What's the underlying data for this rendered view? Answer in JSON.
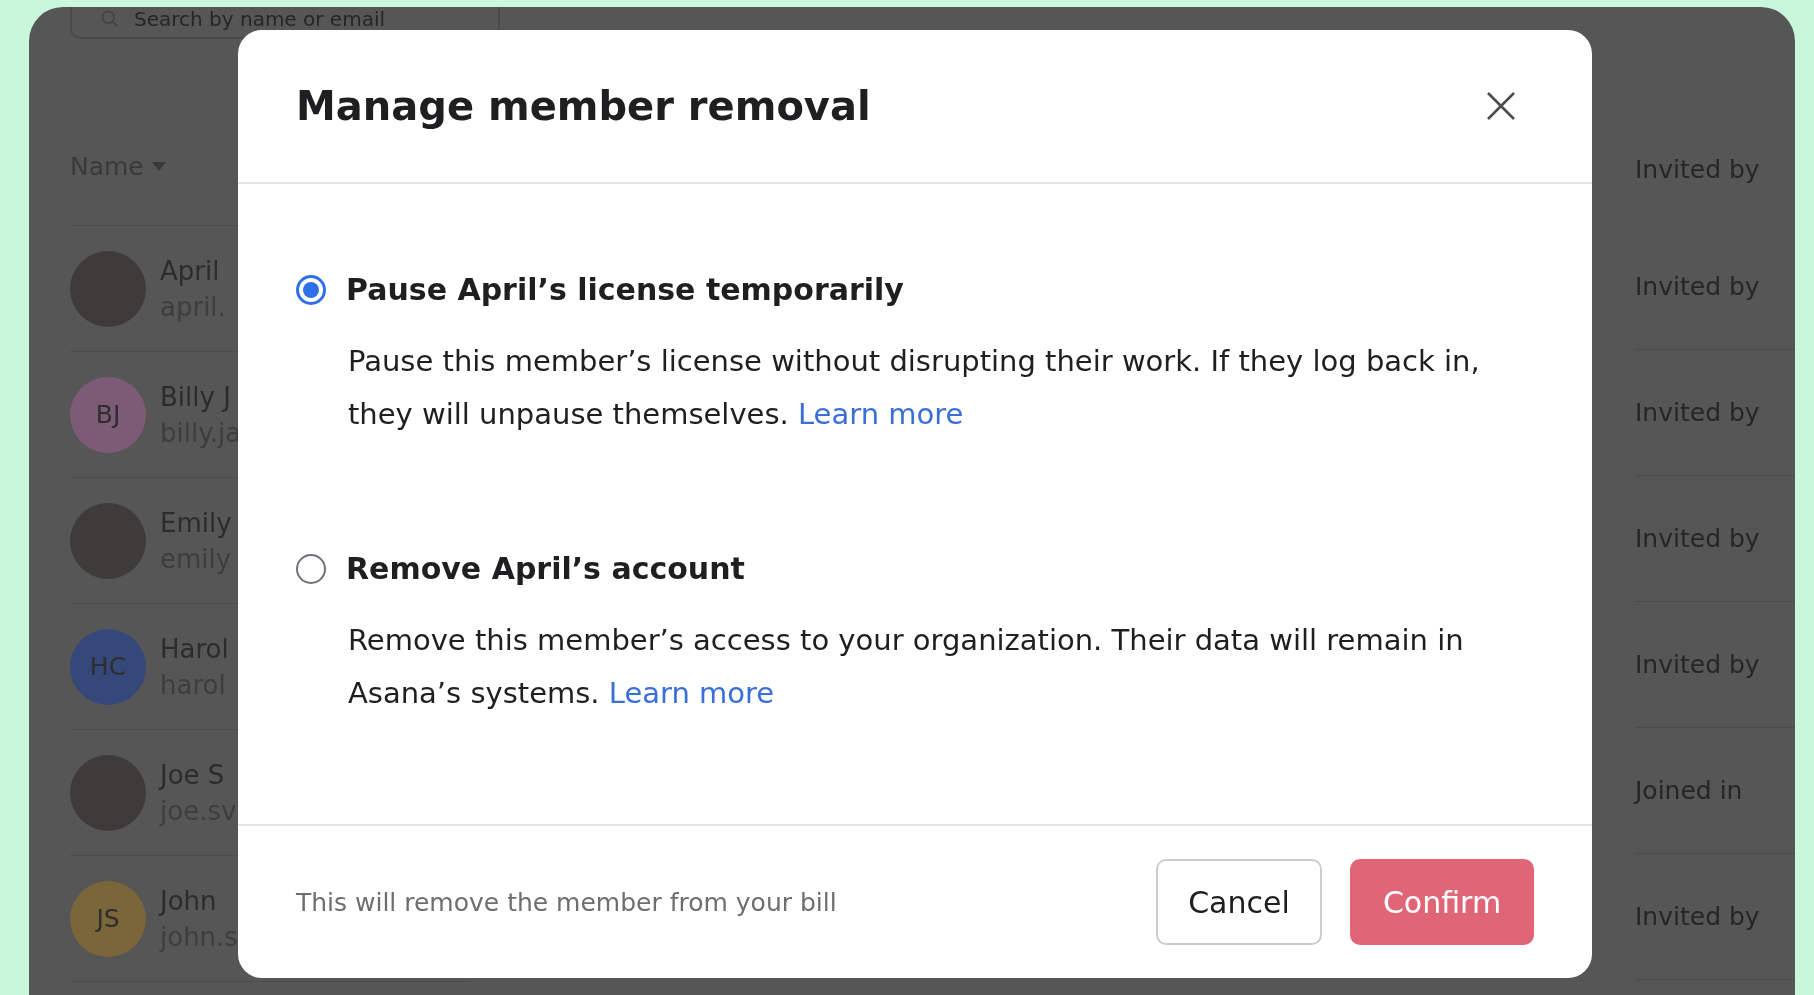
{
  "background": {
    "search": {
      "placeholder": "Search by name or email"
    },
    "name_column": "Name",
    "right_column_header": "Invited by",
    "rows": [
      {
        "name": "April",
        "email": "april.",
        "avatar": {
          "kind": "photo"
        },
        "status": "Invited by"
      },
      {
        "name": "Billy J",
        "email": "billy.ja",
        "avatar": {
          "kind": "initials",
          "initials": "BJ",
          "color": "#7d5a76"
        },
        "status": "Invited by"
      },
      {
        "name": "Emily",
        "email": "emily",
        "avatar": {
          "kind": "photo"
        },
        "status": "Invited by"
      },
      {
        "name": "Harol",
        "email": "harol",
        "avatar": {
          "kind": "initials",
          "initials": "HC",
          "color": "#34497a"
        },
        "status": "Invited by"
      },
      {
        "name": "Joe S",
        "email": "joe.sv",
        "avatar": {
          "kind": "photo"
        },
        "status": "Joined in"
      },
      {
        "name": "John",
        "email": "john.s",
        "avatar": {
          "kind": "initials",
          "initials": "JS",
          "color": "#7a6638"
        },
        "status": "Invited by"
      }
    ]
  },
  "dialog": {
    "title": "Manage member removal",
    "options": [
      {
        "label": "Pause April’s license temporarily",
        "description": "Pause this member’s license without disrupting their work. If they log back in, they will unpause themselves.",
        "link": "Learn more",
        "selected": true
      },
      {
        "label": "Remove April’s account",
        "description": "Remove this member’s access to your organization. Their data will remain in Asana’s systems.",
        "link": "Learn more",
        "selected": false
      }
    ],
    "footer_note": "This will remove the member from your bill",
    "buttons": [
      {
        "label": "Cancel",
        "kind": "secondary"
      },
      {
        "label": "Confirm",
        "kind": "primary"
      }
    ]
  }
}
